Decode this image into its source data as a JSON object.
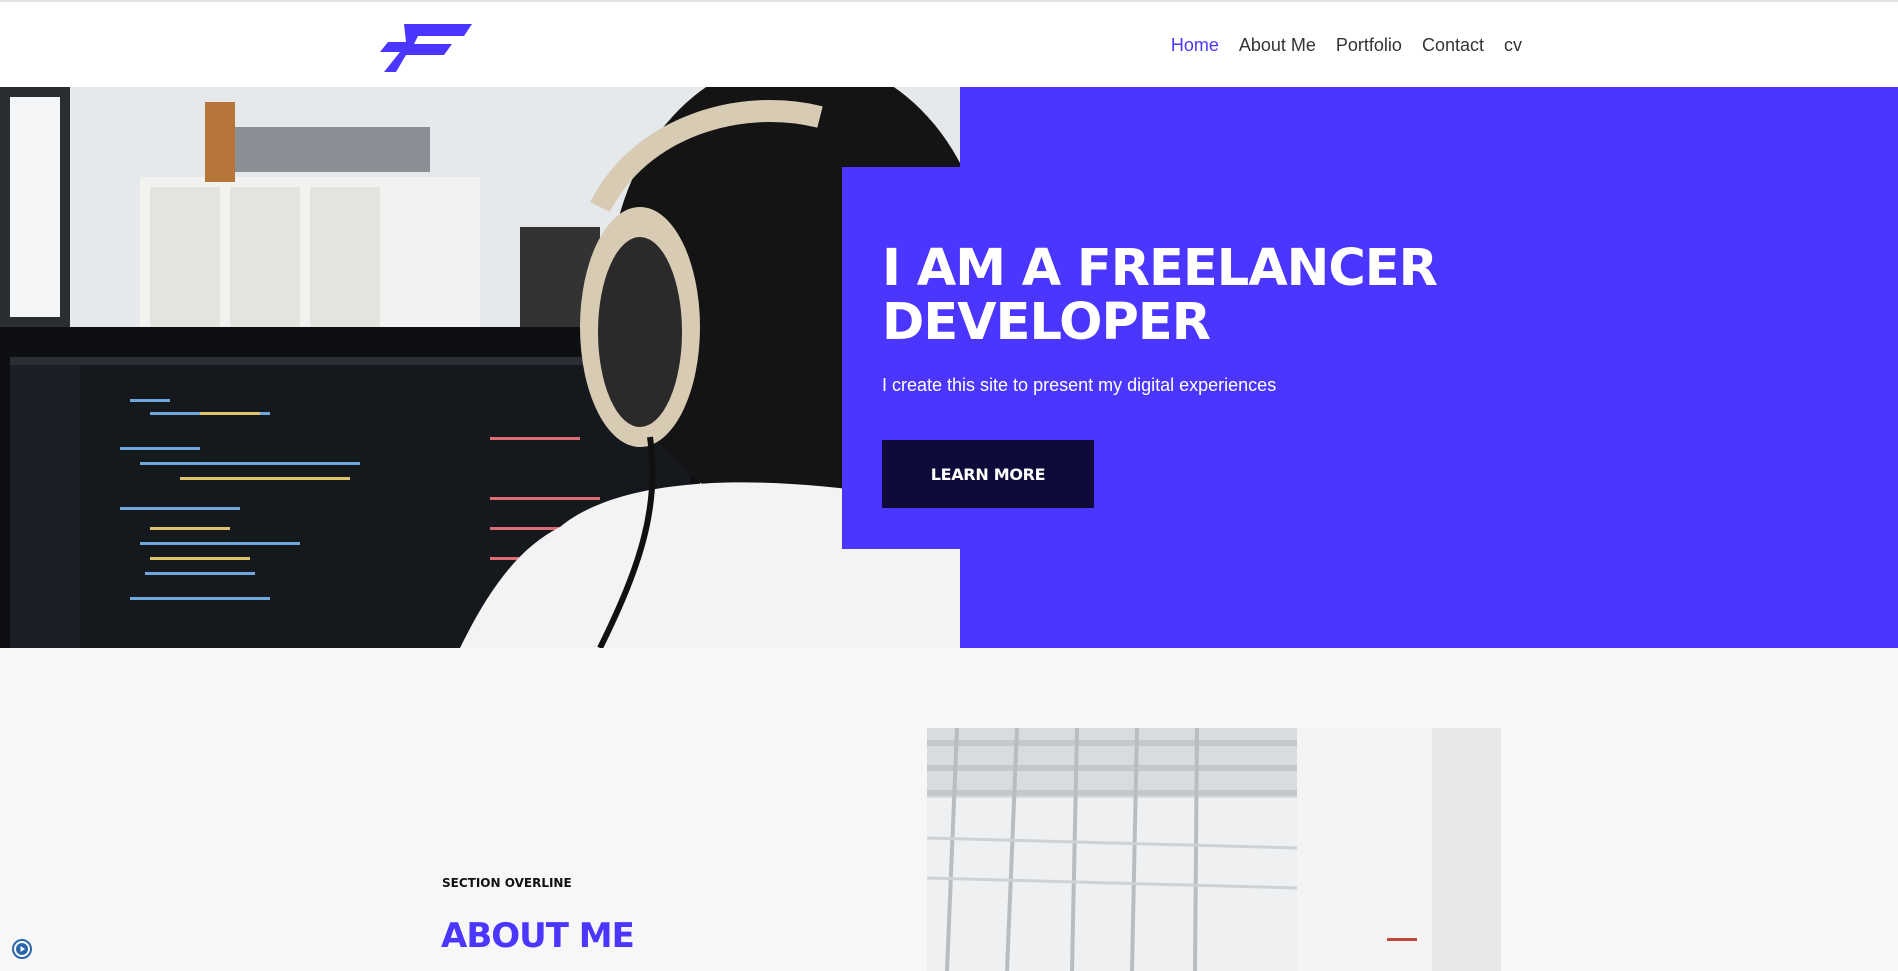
{
  "nav": {
    "items": [
      {
        "label": "Home",
        "active": true
      },
      {
        "label": "About Me",
        "active": false
      },
      {
        "label": "Portfolio",
        "active": false
      },
      {
        "label": "Contact",
        "active": false
      },
      {
        "label": "cv",
        "active": false
      }
    ]
  },
  "hero": {
    "title": "I AM A FREELANCER DEVELOPER",
    "subtitle": "I create this site to present my digital experiences",
    "button_label": "LEARN MORE"
  },
  "about": {
    "overline": "SECTION OVERLINE",
    "title": "ABOUT ME"
  },
  "colors": {
    "accent": "#4b36ff",
    "button_dark": "#0e0a3a",
    "about_bg": "#f7f7f7"
  },
  "icons": {
    "logo": "f-logo-icon",
    "floating": "play-circle-icon"
  }
}
